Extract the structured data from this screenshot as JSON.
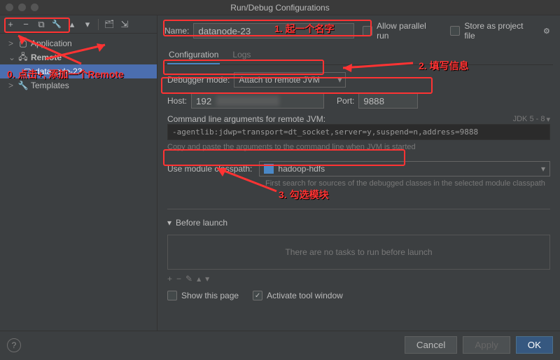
{
  "titlebar": {
    "text": "Run/Debug Configurations"
  },
  "toolbar": {
    "add": "+",
    "remove": "−",
    "copy": "⧉",
    "wrench": "🔧",
    "up": "▴",
    "down": "▾",
    "folder": "🗂",
    "collapse": "⇲"
  },
  "tree": {
    "application": {
      "label": "Application",
      "toggle": ">"
    },
    "remote": {
      "label": "Remote",
      "toggle": "⌄"
    },
    "config": {
      "label": "datanode-23"
    },
    "templates": {
      "label": "Templates",
      "toggle": ">"
    }
  },
  "header": {
    "name_label": "Name:",
    "name_value": "datanode-23",
    "allow_parallel": "Allow parallel run",
    "store_as_file": "Store as project file"
  },
  "tabs": {
    "configuration": "Configuration",
    "logs": "Logs"
  },
  "debugger": {
    "mode_label": "Debugger mode:",
    "mode_value": "Attach to remote JVM",
    "host_label": "Host:",
    "host_value": "192",
    "port_label": "Port:",
    "port_value": "9888",
    "cmdline_label": "Command line arguments for remote JVM:",
    "cmdline_value": "-agentlib:jdwp=transport=dt_socket,server=y,suspend=n,address=9888",
    "cmdline_hint": "Copy and paste the arguments to the command line when JVM is started",
    "jdk_tag": "JDK 5 - 8",
    "module_label": "Use module classpath:",
    "module_value": "hadoop-hdfs",
    "module_hint": "First search for sources of the debugged classes in the selected module classpath"
  },
  "before_launch": {
    "header": "Before launch",
    "empty": "There are no tasks to run before launch",
    "add": "+",
    "remove": "−",
    "edit": "✎",
    "up": "▴",
    "down": "▾",
    "show_page": "Show this page",
    "activate_window": "Activate tool window"
  },
  "footer": {
    "cancel": "Cancel",
    "apply": "Apply",
    "ok": "OK"
  },
  "annotations": {
    "step0": "0. 点击+, 添加一个Remote",
    "step1": "1. 起一个名字",
    "step2": "2. 填写信息",
    "step3": "3. 勾选模块"
  }
}
